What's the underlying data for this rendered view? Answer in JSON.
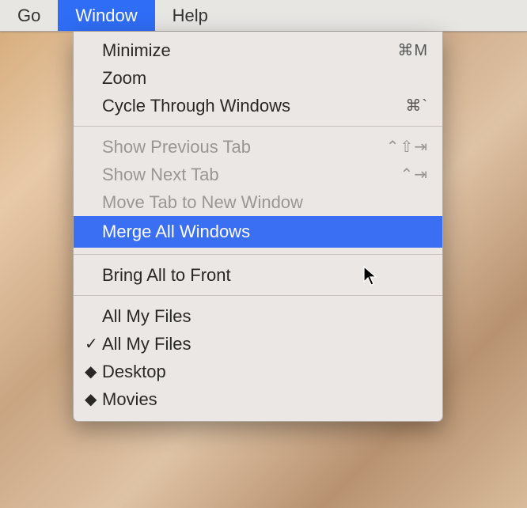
{
  "menubar": {
    "items": [
      {
        "label": "Go",
        "active": false
      },
      {
        "label": "Window",
        "active": true
      },
      {
        "label": "Help",
        "active": false
      }
    ]
  },
  "dropdown": {
    "groups": [
      [
        {
          "label": "Minimize",
          "shortcut": "⌘M",
          "enabled": true,
          "highlight": false,
          "mark": ""
        },
        {
          "label": "Zoom",
          "shortcut": "",
          "enabled": true,
          "highlight": false,
          "mark": ""
        },
        {
          "label": "Cycle Through Windows",
          "shortcut": "⌘`",
          "enabled": true,
          "highlight": false,
          "mark": ""
        }
      ],
      [
        {
          "label": "Show Previous Tab",
          "shortcut": "⌃⇧⇥",
          "enabled": false,
          "highlight": false,
          "mark": ""
        },
        {
          "label": "Show Next Tab",
          "shortcut": "⌃⇥",
          "enabled": false,
          "highlight": false,
          "mark": ""
        },
        {
          "label": "Move Tab to New Window",
          "shortcut": "",
          "enabled": false,
          "highlight": false,
          "mark": ""
        },
        {
          "label": "Merge All Windows",
          "shortcut": "",
          "enabled": true,
          "highlight": true,
          "mark": ""
        }
      ],
      [
        {
          "label": "Bring All to Front",
          "shortcut": "",
          "enabled": true,
          "highlight": false,
          "mark": ""
        }
      ],
      [
        {
          "label": "All My Files",
          "shortcut": "",
          "enabled": true,
          "highlight": false,
          "mark": ""
        },
        {
          "label": "All My Files",
          "shortcut": "",
          "enabled": true,
          "highlight": false,
          "mark": "✓"
        },
        {
          "label": "Desktop",
          "shortcut": "",
          "enabled": true,
          "highlight": false,
          "mark": "◆"
        },
        {
          "label": "Movies",
          "shortcut": "",
          "enabled": true,
          "highlight": false,
          "mark": "◆"
        }
      ]
    ]
  }
}
